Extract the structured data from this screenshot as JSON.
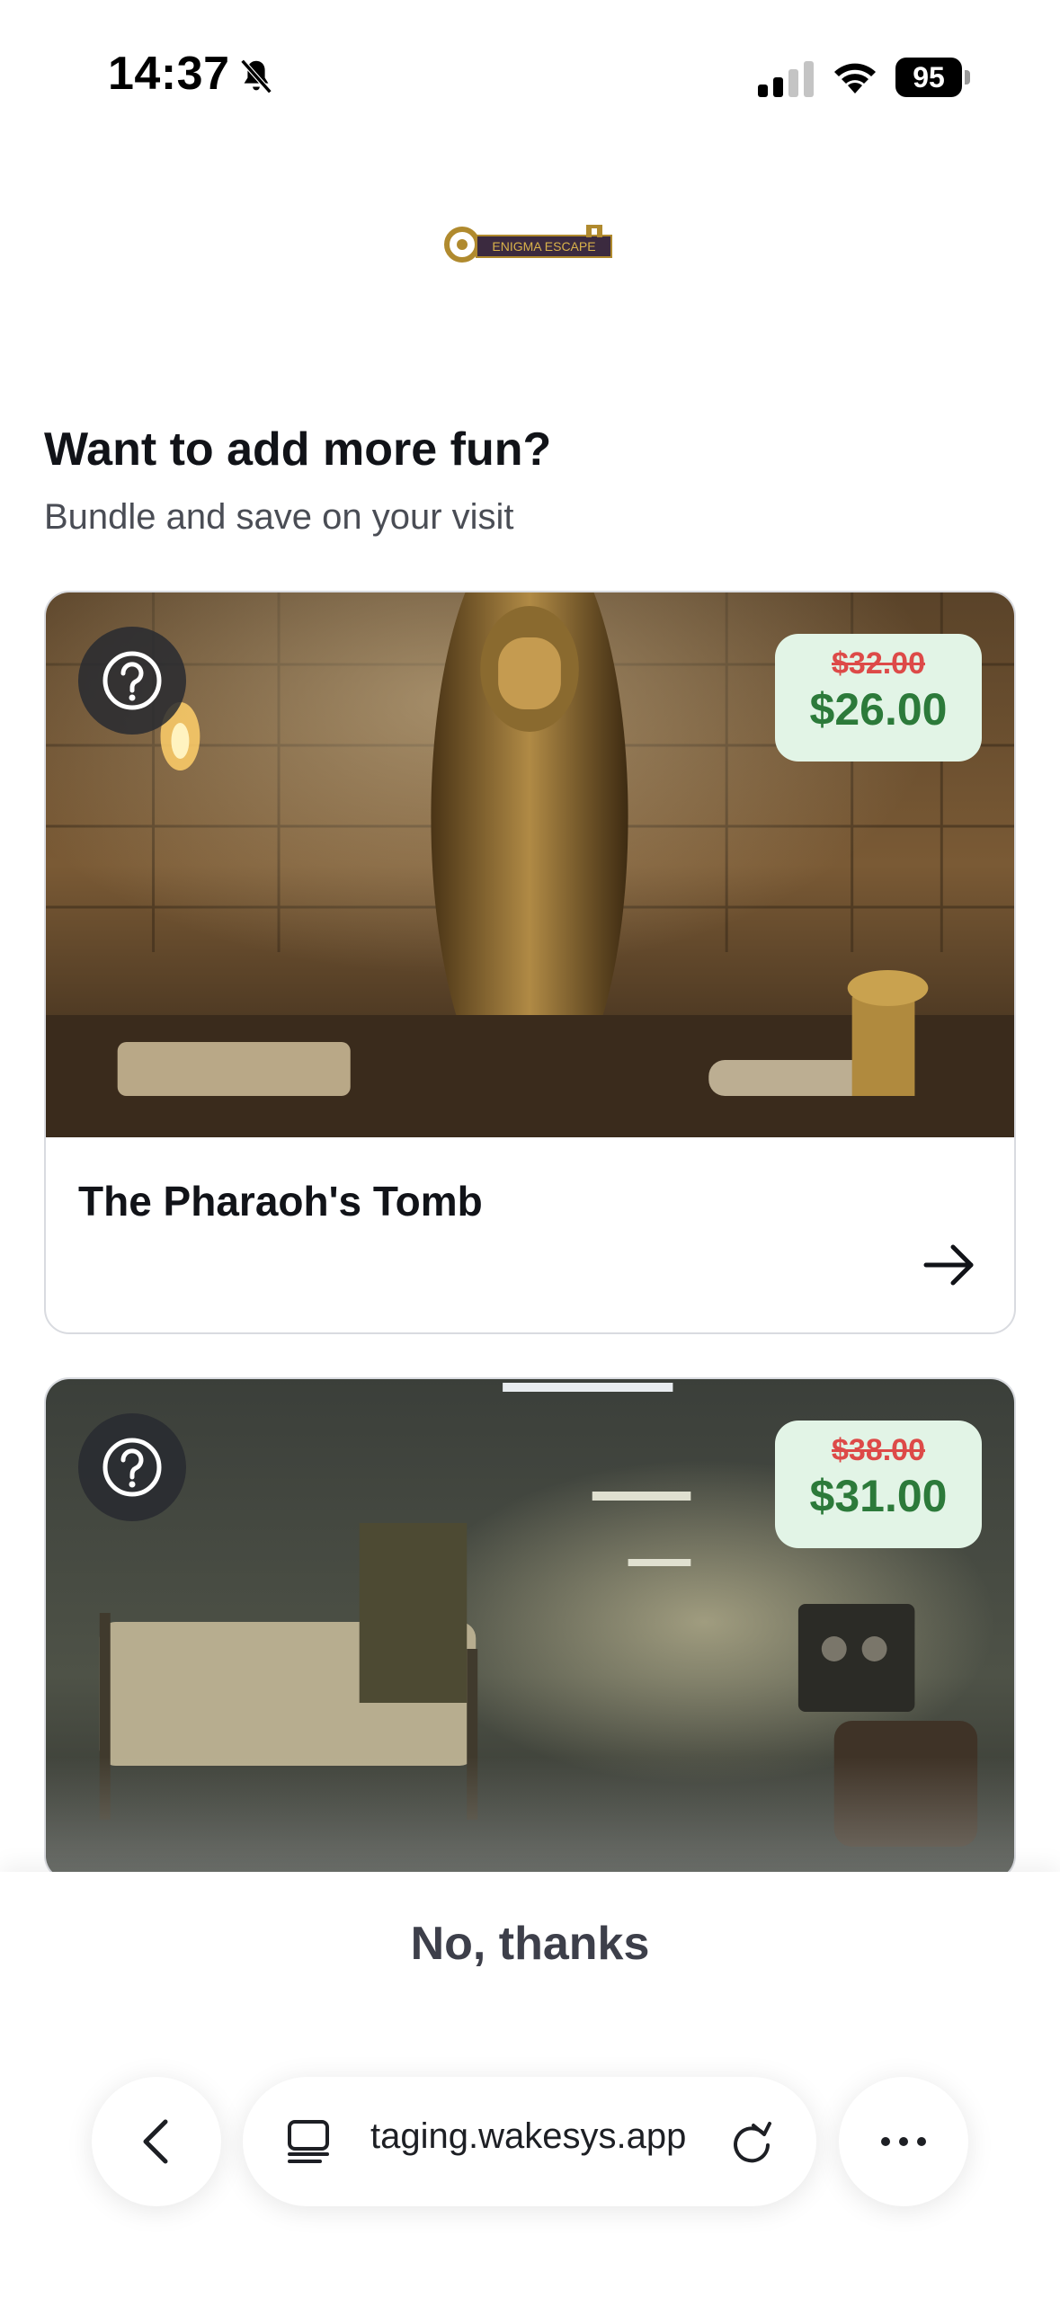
{
  "status_bar": {
    "time": "14:37",
    "battery": "95",
    "icons": [
      "bell-slash-icon",
      "signal-icon",
      "wifi-icon",
      "battery-icon"
    ]
  },
  "brand": {
    "logo_text": "ENIGMA ESCAPE"
  },
  "header": {
    "title": "Want to add more fun?",
    "subtitle": "Bundle and save on your visit"
  },
  "cards": [
    {
      "title": "The Pharaoh's Tomb",
      "old_price": "$32.00",
      "new_price": "$26.00",
      "icon": "help-icon"
    },
    {
      "title": "",
      "old_price": "$38.00",
      "new_price": "$31.00",
      "icon": "help-icon"
    }
  ],
  "actions": {
    "decline_label": "No, thanks"
  },
  "browser": {
    "url": "taging.wakesys.app",
    "icons": [
      "back-icon",
      "tabs-icon",
      "reload-icon",
      "more-icon"
    ]
  },
  "colors": {
    "price_bg": "#e2f4e6",
    "new_price": "#2c7a3a",
    "old_price": "#dd4a48",
    "text": "#111318"
  }
}
